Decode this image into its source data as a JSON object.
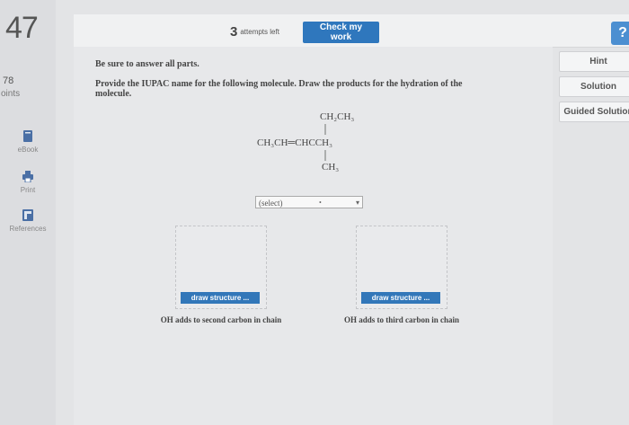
{
  "sidebar": {
    "question_number": "47",
    "points_value": "78",
    "points_label": "oints",
    "items": [
      {
        "label": "eBook",
        "icon": "book-icon"
      },
      {
        "label": "Print",
        "icon": "printer-icon"
      },
      {
        "label": "References",
        "icon": "references-icon"
      }
    ]
  },
  "header": {
    "attempts_count": "3",
    "attempts_text": "attempts left",
    "check_label": "Check my work",
    "help_label": "?"
  },
  "right_panel": {
    "hint": "Hint",
    "solution": "Solution",
    "guided": "Guided Solution"
  },
  "question": {
    "instruction": "Be sure to answer all parts.",
    "text": "Provide the IUPAC name for the following molecule. Draw the products for the hydration of the molecule.",
    "molecule": {
      "top_group": "CH₂CH₃",
      "main_chain": "CH₃CH═CHCCH₃",
      "bottom_group": "CH₃"
    },
    "select_value": "(select)"
  },
  "draw": [
    {
      "button": "draw structure ...",
      "caption": "OH adds to second carbon in chain"
    },
    {
      "button": "draw structure ...",
      "caption": "OH adds to third carbon in chain"
    }
  ],
  "colors": {
    "primary": "#2f77bd",
    "help": "#4c8fd1",
    "background": "#e3e4e6"
  }
}
